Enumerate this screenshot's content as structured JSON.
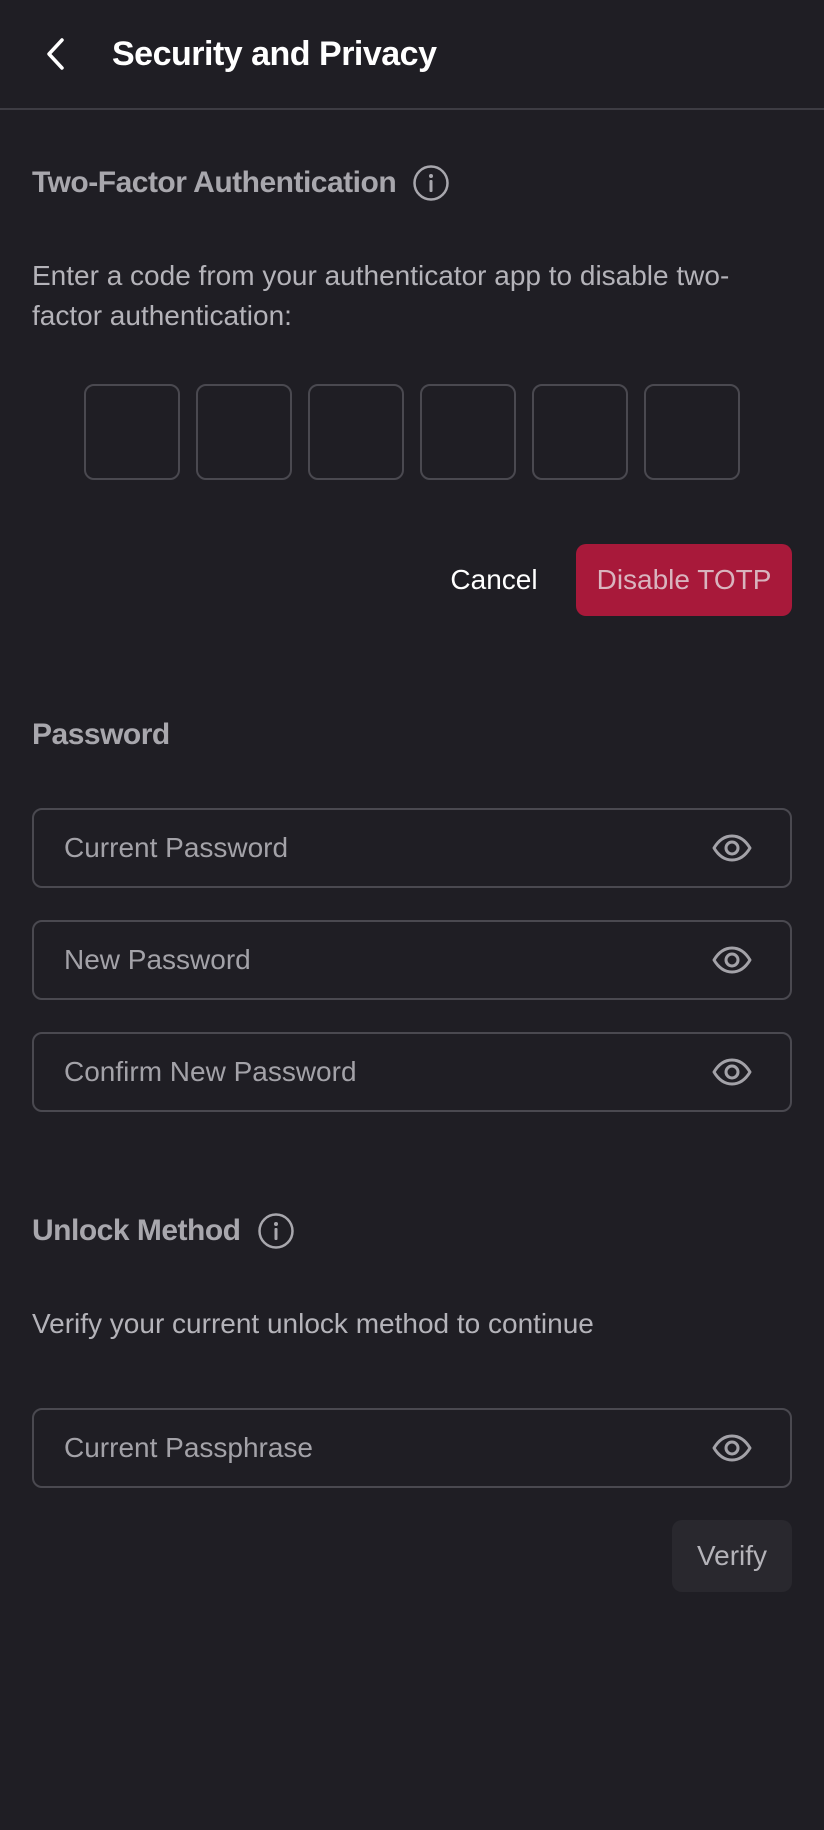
{
  "header": {
    "title": "Security and Privacy",
    "back_icon": "chevron-left-icon"
  },
  "two_factor": {
    "title": "Two-Factor Authentication",
    "info_icon": "info-icon",
    "description": "Enter a code from your authenticator app to disable two-factor authentication:",
    "code_digits": [
      "",
      "",
      "",
      "",
      "",
      ""
    ],
    "cancel_label": "Cancel",
    "disable_label": "Disable TOTP"
  },
  "password": {
    "title": "Password",
    "fields": [
      {
        "placeholder": "Current Password",
        "value": ""
      },
      {
        "placeholder": "New Password",
        "value": ""
      },
      {
        "placeholder": "Confirm New Password",
        "value": ""
      }
    ],
    "visibility_icon": "eye-icon"
  },
  "unlock": {
    "title": "Unlock Method",
    "info_icon": "info-icon",
    "description": "Verify your current unlock method to continue",
    "passphrase_placeholder": "Current Passphrase",
    "passphrase_value": "",
    "verify_label": "Verify"
  },
  "colors": {
    "background": "#1f1e24",
    "danger": "#a8193a",
    "border": "#4a4950",
    "muted_text": "#a8a7ad"
  }
}
